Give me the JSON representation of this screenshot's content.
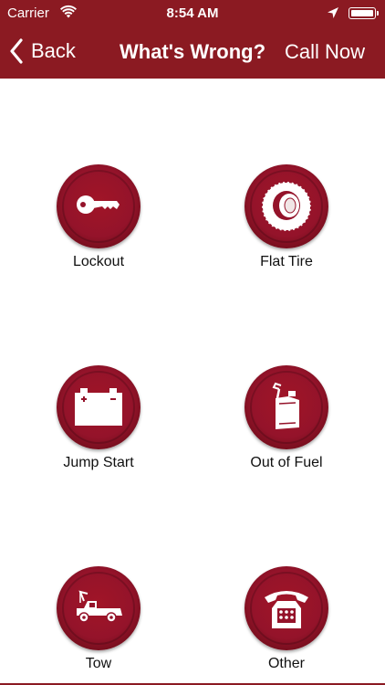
{
  "status": {
    "carrier": "Carrier",
    "time": "8:54 AM"
  },
  "nav": {
    "back_label": "Back",
    "title": "What's Wrong?",
    "action_label": "Call Now"
  },
  "services": [
    {
      "label": "Lockout",
      "icon": "key-icon"
    },
    {
      "label": "Flat Tire",
      "icon": "tire-icon"
    },
    {
      "label": "Jump Start",
      "icon": "battery-icon"
    },
    {
      "label": "Out of Fuel",
      "icon": "fuel-can-icon"
    },
    {
      "label": "Tow",
      "icon": "tow-truck-icon"
    },
    {
      "label": "Other",
      "icon": "telephone-icon"
    }
  ],
  "colors": {
    "brand": "#8b1a22",
    "button": "#94132a"
  }
}
